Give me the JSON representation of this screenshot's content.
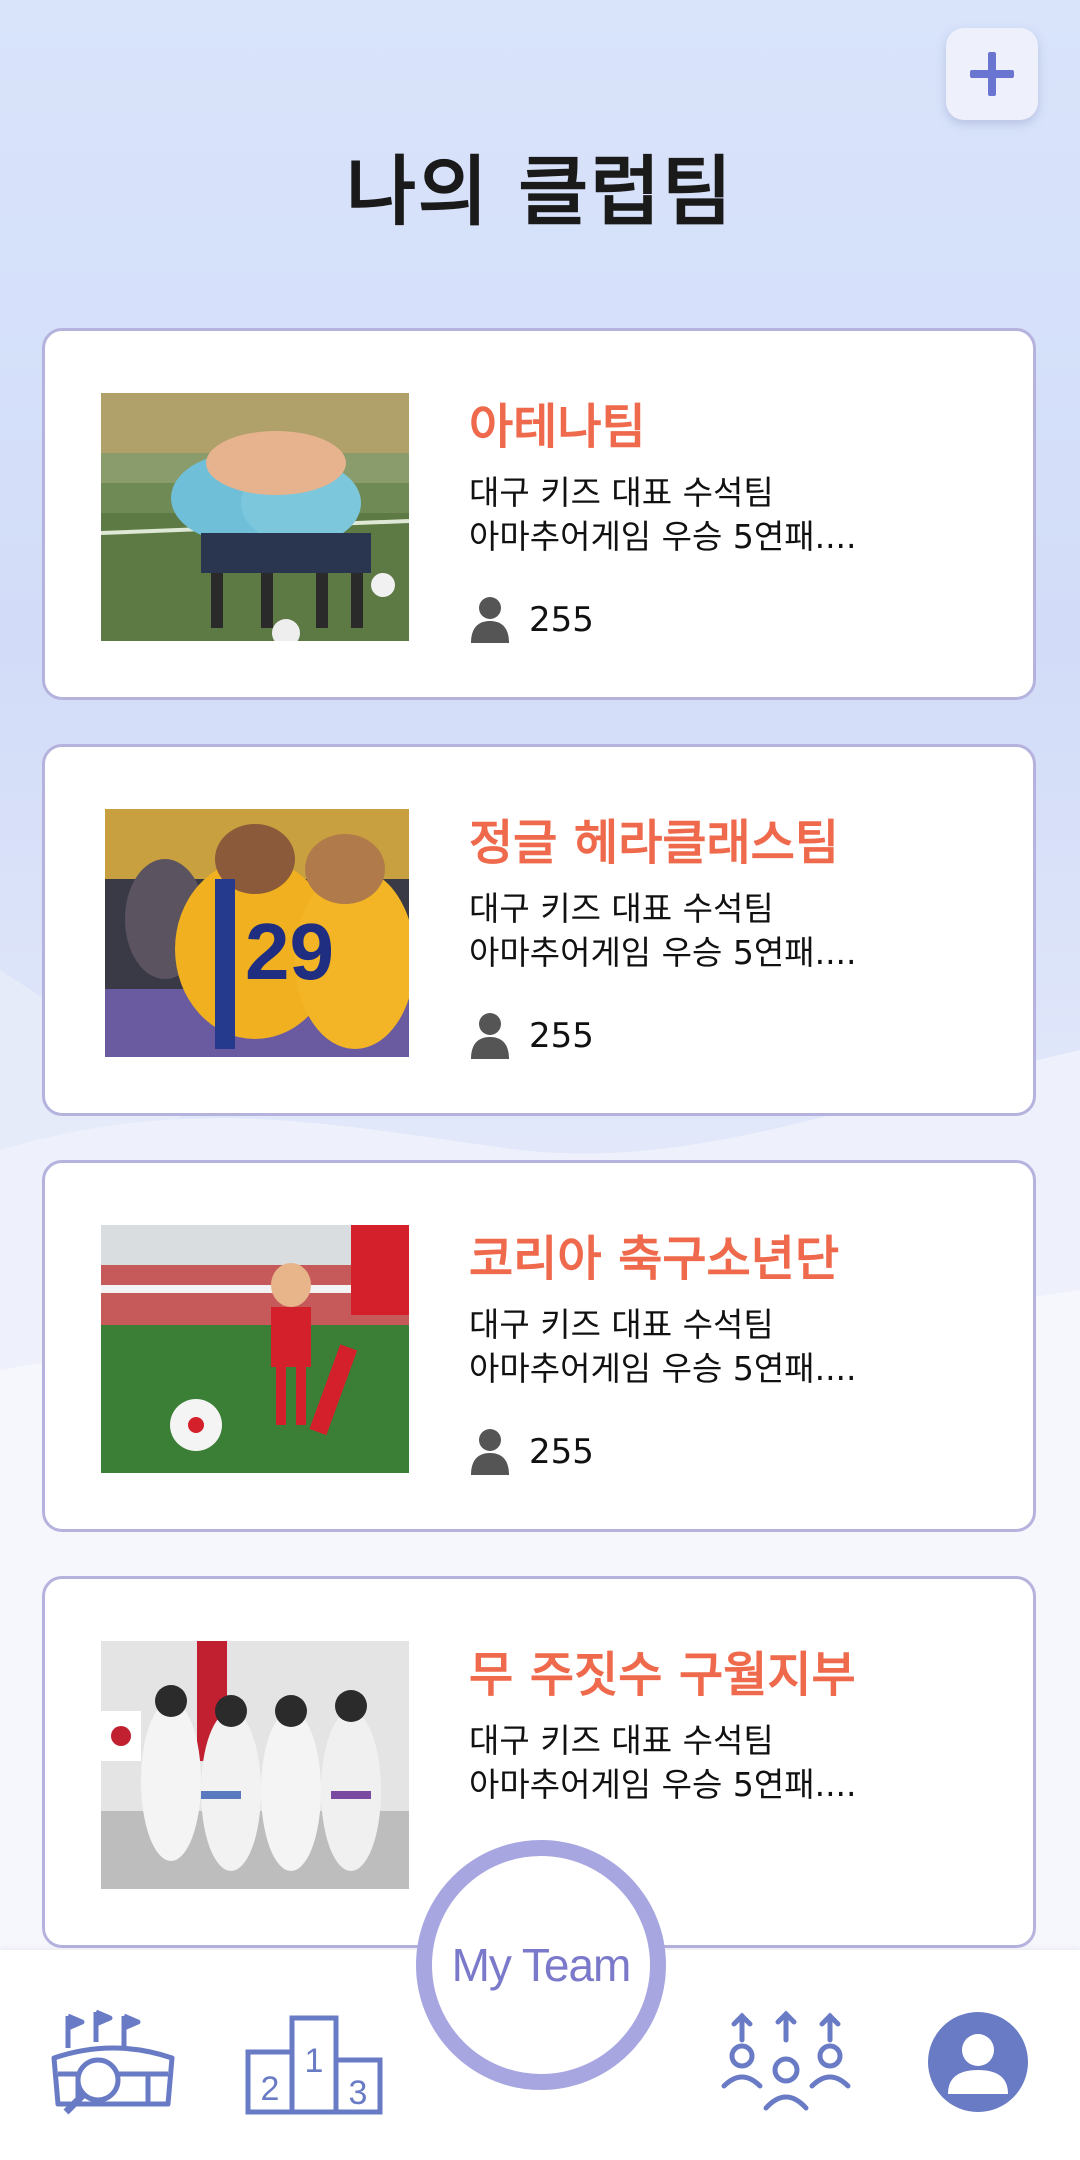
{
  "header": {
    "title": "나의 클럽팀",
    "add_icon": "plus-icon"
  },
  "teams": [
    {
      "name": "아테나팀",
      "desc_line1": "대구 키즈 대표 수석팀",
      "desc_line2": "아마추어게임 우승 5연패....",
      "members": "255"
    },
    {
      "name": "정글 헤라클래스팀",
      "desc_line1": "대구 키즈 대표 수석팀",
      "desc_line2": "아마추어게임 우승 5연패....",
      "members": "255"
    },
    {
      "name": "코리아 축구소년단",
      "desc_line1": "대구 키즈 대표 수석팀",
      "desc_line2": "아마추어게임 우승 5연패....",
      "members": "255"
    },
    {
      "name": "무 주짓수 구월지부",
      "desc_line1": "대구 키즈 대표 수석팀",
      "desc_line2": "아마추어게임 우승 5연패...."
    }
  ],
  "bottom_nav": {
    "center_label": "My Team",
    "items": [
      "stadium-search-icon",
      "podium-icon",
      "team-members-icon",
      "profile-icon"
    ]
  },
  "colors": {
    "accent": "#ef6a4c",
    "nav_icon": "#6a7bc5",
    "card_border": "#b5b3de",
    "myteam_ring": "#a8a6e0"
  }
}
